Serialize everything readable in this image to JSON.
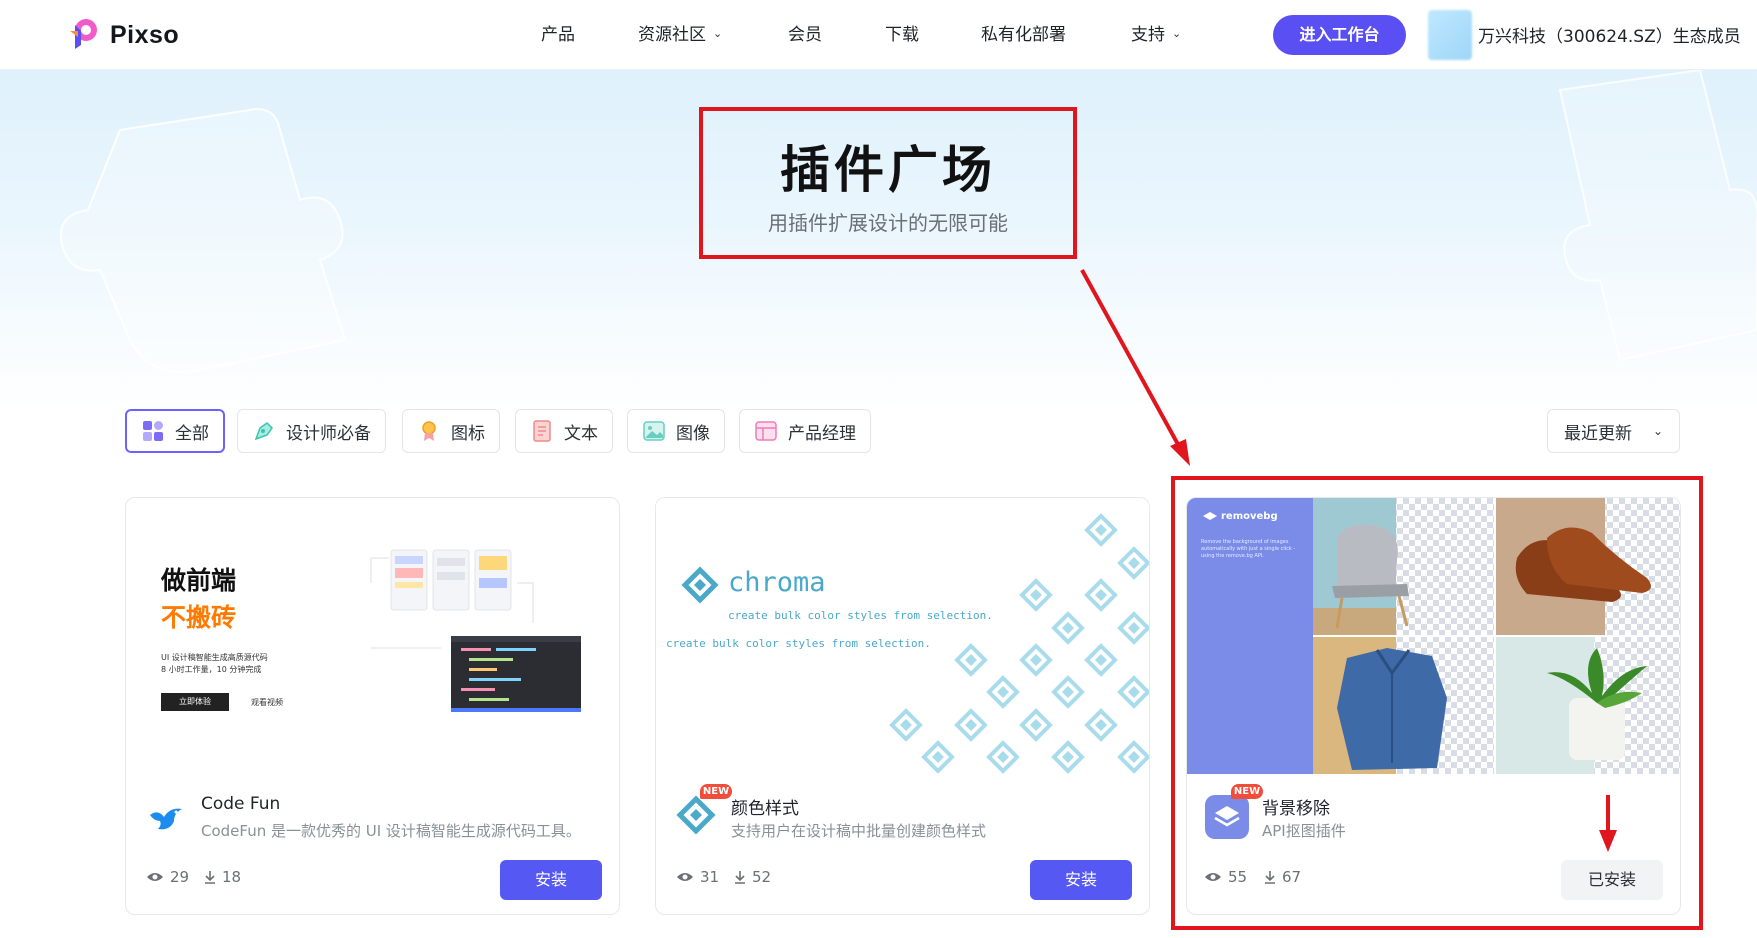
{
  "header": {
    "logo_text": "Pixso",
    "nav": [
      {
        "label": "产品",
        "has_dropdown": false
      },
      {
        "label": "资源社区",
        "has_dropdown": true
      },
      {
        "label": "会员",
        "has_dropdown": false
      },
      {
        "label": "下载",
        "has_dropdown": false
      },
      {
        "label": "私有化部署",
        "has_dropdown": false
      },
      {
        "label": "支持",
        "has_dropdown": true
      }
    ],
    "cta_label": "进入工作台",
    "user_org": "万兴科技（300624.SZ）生态成员"
  },
  "hero": {
    "title": "插件广场",
    "subtitle": "用插件扩展设计的无限可能"
  },
  "filters": {
    "chips": [
      {
        "label": "全部",
        "icon": "grid-icon",
        "active": true
      },
      {
        "label": "设计师必备",
        "icon": "pen-tool-icon",
        "active": false
      },
      {
        "label": "图标",
        "icon": "award-icon",
        "active": false
      },
      {
        "label": "文本",
        "icon": "document-icon",
        "active": false
      },
      {
        "label": "图像",
        "icon": "image-icon",
        "active": false
      },
      {
        "label": "产品经理",
        "icon": "layout-icon",
        "active": false
      }
    ],
    "sort_label": "最近更新"
  },
  "plugins": [
    {
      "name": "Code Fun",
      "description": "CodeFun 是一款优秀的 UI 设计稿智能生成源代码工具。",
      "views": "29",
      "downloads": "18",
      "action": "安装",
      "is_new": false,
      "cover": {
        "headline1": "做前端",
        "headline2": "不搬砖",
        "line1": "UI 设计稿智能生成高质源代码",
        "line2": "8 小时工作量，10 分钟完成",
        "button": "立即体验",
        "link": "观看视频"
      }
    },
    {
      "name": "颜色样式",
      "description": "支持用户在设计稿中批量创建颜色样式",
      "views": "31",
      "downloads": "52",
      "action": "安装",
      "is_new": true,
      "new_badge": "NEW",
      "cover": {
        "brand": "chroma",
        "tagline1": "create bulk color styles from selection.",
        "tagline2": "create bulk color styles from selection."
      }
    },
    {
      "name": "背景移除",
      "description": "API抠图插件",
      "views": "55",
      "downloads": "67",
      "action": "已安装",
      "is_new": true,
      "new_badge": "NEW",
      "cover": {
        "brand": "removebg",
        "blurb": "Remove the background of images automatically with just a single click - using the remove.bg API."
      }
    }
  ],
  "colors": {
    "brand_purple": "#5a4ff3",
    "install_blue": "#5558f2",
    "annotation_red": "#e0151d",
    "new_badge": "#f04d3a"
  }
}
